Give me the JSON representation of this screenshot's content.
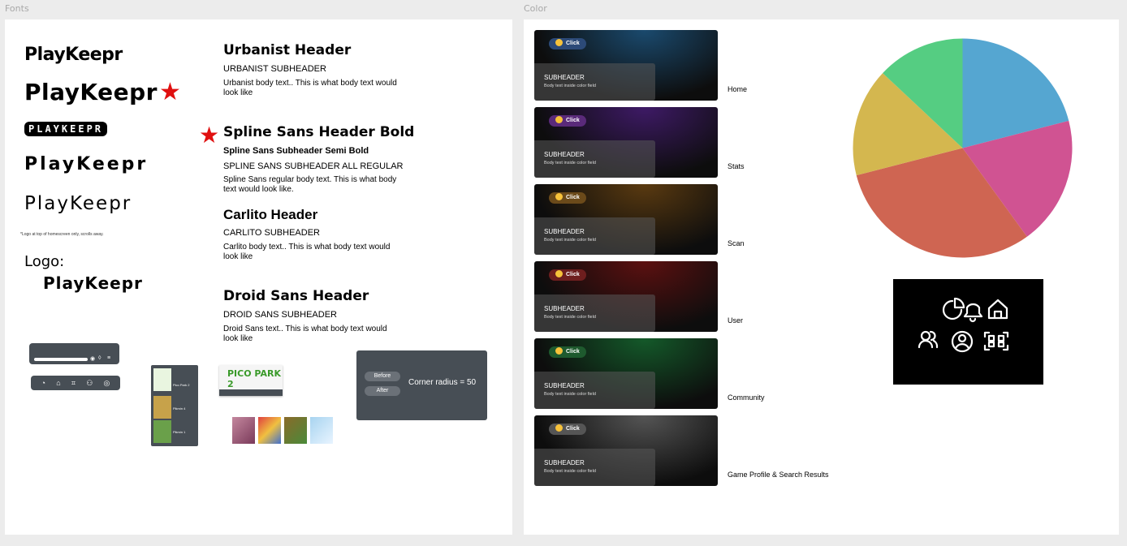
{
  "frames": {
    "fonts_label": "Fonts",
    "color_label": "Color"
  },
  "logos": {
    "wordmark": "PlayKeepr",
    "wordmark_caps": "PLAYKEEPR",
    "star": "★",
    "note": "*Logo at top of homescreen only, scrolls away.",
    "logo_label": "Logo:"
  },
  "fonts": {
    "urbanist": {
      "header": "Urbanist Header",
      "subheader": "URBANIST SUBHEADER",
      "body": "Urbanist body text.. This is what body text would look like"
    },
    "spline": {
      "header": "Spline Sans Header Bold",
      "semibold": "Spline Sans Subheader Semi Bold",
      "subheader": "SPLINE SANS SUBHEADER ALL REGULAR",
      "body": "Spline Sans regular body text. This is what body text would look like."
    },
    "carlito": {
      "header": "Carlito Header",
      "subheader": "CARLITO SUBHEADER",
      "body": "Carlito body text.. This is what body text would look like"
    },
    "droid": {
      "header": "Droid Sans Header",
      "subheader": "DROID SANS SUBHEADER",
      "body": "Droid Sans text.. This is what body text would look like"
    }
  },
  "mockups": {
    "pico_title": "PICO PARK 2",
    "radius": {
      "before": "Before",
      "after": "After",
      "label": "Corner radius = 50"
    },
    "phone_items": [
      "Pico Park 2",
      "Pikmin 4",
      "Pikmin 1"
    ]
  },
  "color_cards": [
    {
      "click": "Click",
      "subheader": "SUBHEADER",
      "body": "Body text inside color field",
      "label": "Home",
      "pill_color": "#2c4a78",
      "glow": "#1a4a6e"
    },
    {
      "click": "Click",
      "subheader": "SUBHEADER",
      "body": "Body text inside color field",
      "label": "Stats",
      "pill_color": "#5a2a7a",
      "glow": "#3e1a66"
    },
    {
      "click": "Click",
      "subheader": "SUBHEADER",
      "body": "Body text inside color field",
      "label": "Scan",
      "pill_color": "#6b4a1a",
      "glow": "#5a3a10"
    },
    {
      "click": "Click",
      "subheader": "SUBHEADER",
      "body": "Body text inside color field",
      "label": "User",
      "pill_color": "#6e1e1e",
      "glow": "#5c1010"
    },
    {
      "click": "Click",
      "subheader": "SUBHEADER",
      "body": "Body text inside color field",
      "label": "Community",
      "pill_color": "#1e5a2e",
      "glow": "#145a2a"
    },
    {
      "click": "Click",
      "subheader": "SUBHEADER",
      "body": "Body text inside color field",
      "label": "Game Profile & Search Results",
      "pill_color": "#555555",
      "glow": "#555555"
    }
  ],
  "pie_colors": [
    "#55a6d1",
    "#d05392",
    "#cf6552",
    "#d4b74f",
    "#55cd82"
  ],
  "nav_icons": [
    "pie-chart-icon",
    "bell-icon",
    "home-icon",
    "users-icon",
    "user-circle-icon",
    "scan-icon"
  ]
}
